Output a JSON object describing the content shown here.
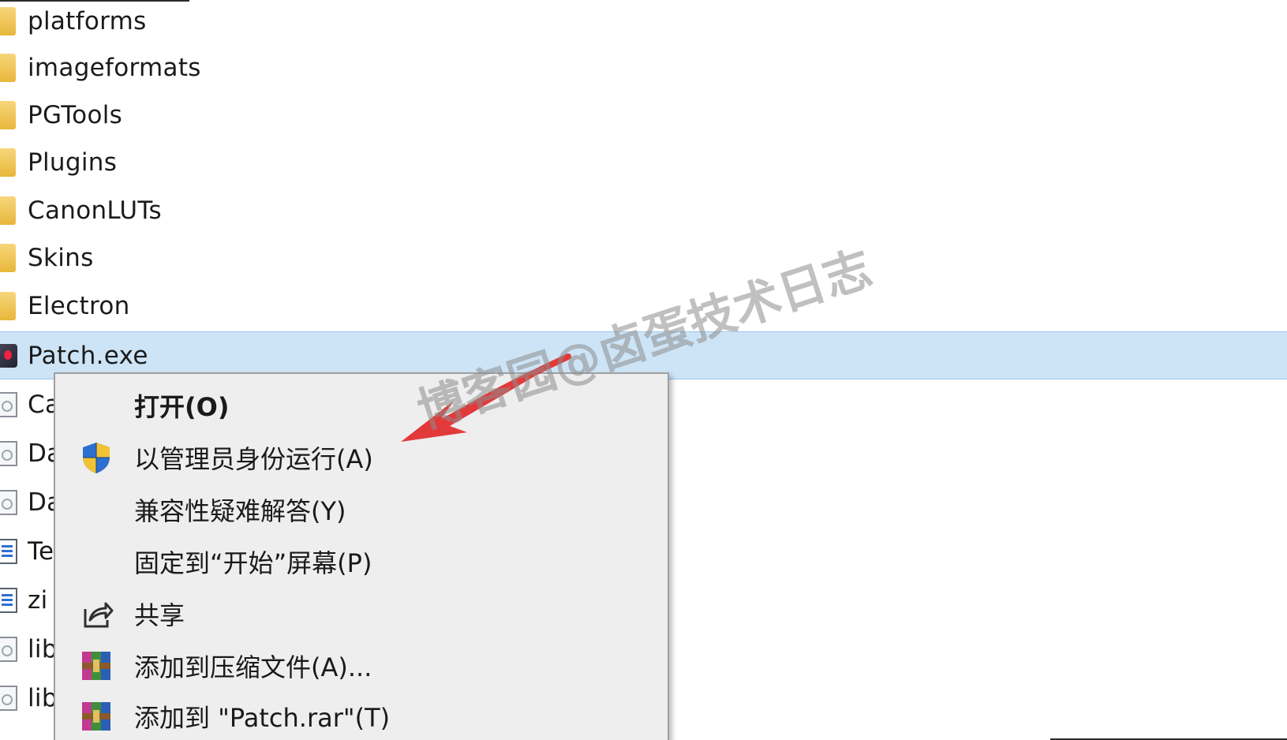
{
  "files": [
    {
      "name": "platforms",
      "icon": "folder-icon"
    },
    {
      "name": "imageformats",
      "icon": "folder-icon"
    },
    {
      "name": "PGTools",
      "icon": "folder-icon"
    },
    {
      "name": "Plugins",
      "icon": "folder-icon"
    },
    {
      "name": "CanonLUTs",
      "icon": "folder-icon"
    },
    {
      "name": "Skins",
      "icon": "folder-icon"
    },
    {
      "name": "Electron",
      "icon": "folder-icon"
    },
    {
      "name": "Patch.exe",
      "icon": "exe-icon"
    },
    {
      "name": "Ca",
      "icon": "dll-file-icon"
    },
    {
      "name": "Da",
      "icon": "dll-file-icon"
    },
    {
      "name": "Da",
      "icon": "dll-file-icon"
    },
    {
      "name": "Te",
      "icon": "text-file-icon"
    },
    {
      "name": "zi",
      "icon": "text-file-icon"
    },
    {
      "name": "lib",
      "icon": "dll-file-icon"
    },
    {
      "name": "lib",
      "icon": "dll-file-icon"
    }
  ],
  "context_menu": {
    "items": [
      {
        "label": "打开(O)",
        "icon": "none",
        "bold": true
      },
      {
        "label": "以管理员身份运行(A)",
        "icon": "uac-shield-icon"
      },
      {
        "label": "兼容性疑难解答(Y)",
        "icon": "none"
      },
      {
        "label": "固定到“开始”屏幕(P)",
        "icon": "none"
      },
      {
        "label": "共享",
        "icon": "share-icon"
      },
      {
        "label": "添加到压缩文件(A)...",
        "icon": "winrar-icon"
      },
      {
        "label": "添加到 \"Patch.rar\"(T)",
        "icon": "winrar-icon"
      }
    ]
  },
  "watermark": {
    "text": "博客园@卤蛋技术日志"
  },
  "colors": {
    "selection": "#cde4f7",
    "arrow": "#e23a3a",
    "folder": "#e8b73c"
  }
}
